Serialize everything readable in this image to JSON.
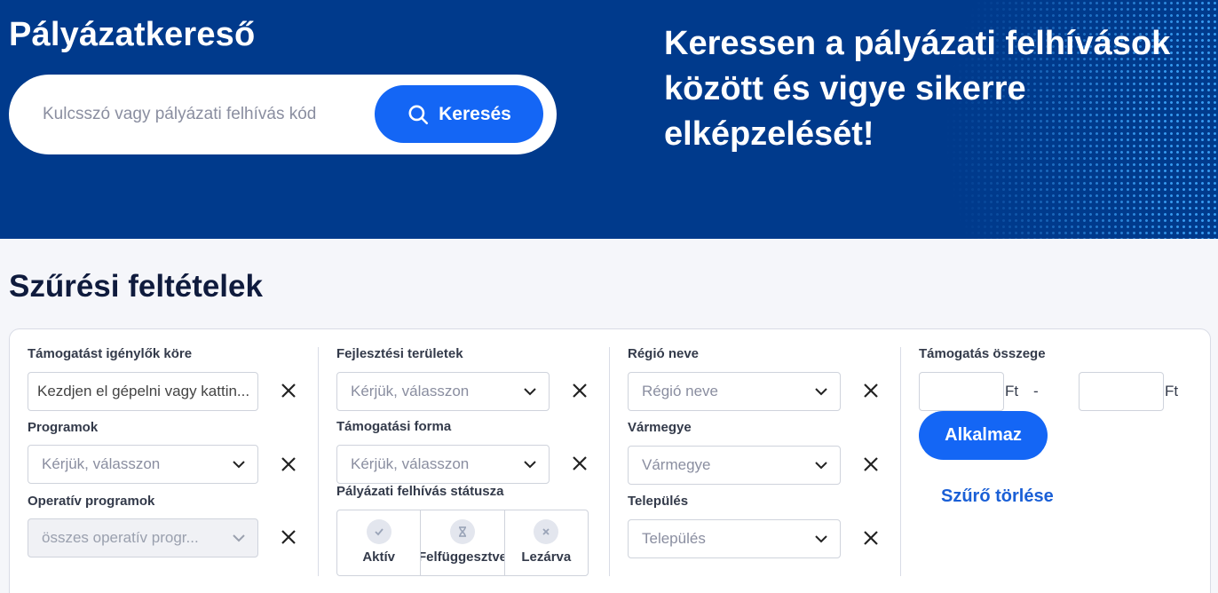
{
  "hero": {
    "title": "Pályázatkereső",
    "search_placeholder": "Kulcsszó vagy pályázati felhívás kód",
    "search_button": "Keresés",
    "slogan_line1": "Keressen a pályázati felhívások",
    "slogan_line2": "között és vigye sikerre",
    "slogan_line3": "elképzelését!"
  },
  "filters": {
    "title": "Szűrési feltételek",
    "applicants": {
      "label": "Támogatást igénylők köre",
      "value": "Kezdjen el gépelni vagy kattin..."
    },
    "programs": {
      "label": "Programok",
      "placeholder": "Kérjük, válasszon"
    },
    "operative": {
      "label": "Operatív programok",
      "placeholder": "összes operatív progr..."
    },
    "development": {
      "label": "Fejlesztési területek",
      "placeholder": "Kérjük, válasszon"
    },
    "support_form": {
      "label": "Támogatási forma",
      "placeholder": "Kérjük, válasszon"
    },
    "status": {
      "label": "Pályázati felhívás státusza",
      "options": [
        "Aktív",
        "Felfüggesztve",
        "Lezárva"
      ]
    },
    "region": {
      "label": "Régió neve",
      "placeholder": "Régió neve"
    },
    "county": {
      "label": "Vármegye",
      "placeholder": "Vármegye"
    },
    "settlement": {
      "label": "Település",
      "placeholder": "Település"
    },
    "amount": {
      "label": "Támogatás összege",
      "currency": "Ft",
      "separator": "-"
    },
    "apply_button": "Alkalmaz",
    "clear_link": "Szűrő törlése"
  },
  "colors": {
    "hero_bg": "#003a8c",
    "accent": "#1466f5",
    "link": "#1a5fd6"
  },
  "icons": {
    "search": "search-icon",
    "chevron": "chevron-down-icon",
    "clear": "close-icon",
    "check": "check-icon",
    "hourglass": "hourglass-icon",
    "x": "x-icon"
  }
}
